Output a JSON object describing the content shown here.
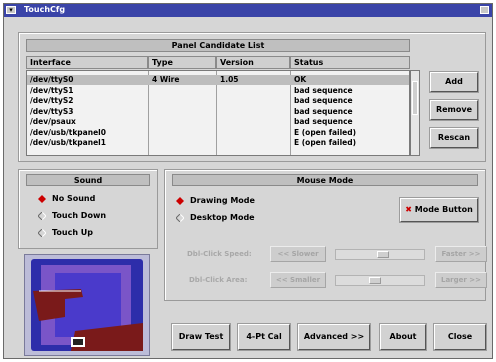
{
  "window": {
    "title": "TouchCfg"
  },
  "panel": {
    "header": "Panel Candidate List",
    "columns": [
      "Interface",
      "Type",
      "Version",
      "Status"
    ],
    "rows": [
      {
        "interface": "/dev/ttyS0",
        "type": "4 Wire",
        "version": "1.05",
        "status": "OK"
      },
      {
        "interface": "/dev/ttyS1",
        "type": "",
        "version": "",
        "status": "bad sequence"
      },
      {
        "interface": "/dev/ttyS2",
        "type": "",
        "version": "",
        "status": "bad sequence"
      },
      {
        "interface": "/dev/ttyS3",
        "type": "",
        "version": "",
        "status": "bad sequence"
      },
      {
        "interface": "/dev/psaux",
        "type": "",
        "version": "",
        "status": "bad sequence"
      },
      {
        "interface": "/dev/usb/tkpanel0",
        "type": "",
        "version": "",
        "status": "E (open failed)"
      },
      {
        "interface": "/dev/usb/tkpanel1",
        "type": "",
        "version": "",
        "status": "E (open failed)"
      }
    ],
    "buttons": {
      "add": "Add",
      "remove": "Remove",
      "rescan": "Rescan"
    }
  },
  "sound": {
    "header": "Sound",
    "options": [
      "No Sound",
      "Touch Down",
      "Touch Up"
    ],
    "selected": "No Sound"
  },
  "mouse": {
    "header": "Mouse Mode",
    "options": [
      "Drawing Mode",
      "Desktop Mode"
    ],
    "selected": "Drawing Mode",
    "mode_button": "Mode Button",
    "speed_label": "Dbl-Click Speed:",
    "area_label": "Dbl-Click Area:",
    "slower": "<< Slower",
    "faster": "Faster >>",
    "smaller": "<< Smaller",
    "larger": "Larger >>",
    "speed_level": 0.55,
    "area_level": 0.45
  },
  "actions": {
    "draw_test": "Draw Test",
    "cal": "4-Pt Cal",
    "advanced": "Advanced >>",
    "about": "About",
    "close": "Close"
  },
  "colors": {
    "titlebar": "#3a44a8",
    "selected_radio": "#cc0000",
    "mode_button_icon": "#cc0000",
    "logo_bg": "#2d2daa",
    "logo_purple": "#7a55c8",
    "logo_hand": "#7a1a1a"
  },
  "icons": [
    "window-menu-icon",
    "maximize-icon",
    "close-x-icon",
    "touch-panel-logo-icon"
  ]
}
